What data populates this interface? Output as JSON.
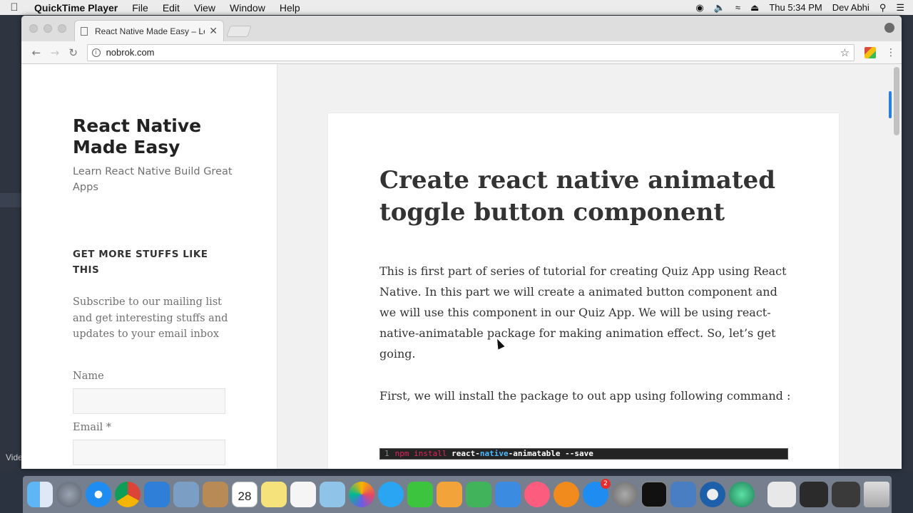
{
  "menubar": {
    "app_name": "QuickTime Player",
    "menus": [
      "File",
      "Edit",
      "View",
      "Window",
      "Help"
    ],
    "clock": "Thu 5:34 PM",
    "user": "Dev Abhi"
  },
  "background": {
    "video_label": "Vide"
  },
  "browser": {
    "tab_title": "React Native Made Easy – Lea",
    "url": "nobrok.com"
  },
  "sidebar": {
    "site_title": "React Native Made Easy",
    "site_description": "Learn React Native Build Great Apps",
    "widget_title": "GET MORE STUFFS LIKE THIS",
    "widget_text": "Subscribe to our mailing list and get interesting stuffs and updates to your email inbox",
    "name_label": "Name",
    "email_label": "Email *"
  },
  "article": {
    "title": "Create react native animated toggle button component",
    "paragraph1": "This is first part of series of tutorial for creating Quiz App using Re­act Native. In this part we will create a animated button component and we will use this component in our Quiz App.  We will be using react-native-animatable package for making animation ef­fect. So, let’s get going.",
    "paragraph2": "First, we will install the package to out app using following com­mand :",
    "code": {
      "line_number": "1",
      "cmd": "npm install",
      "pkg_a": "react-",
      "pkg_b": "native",
      "pkg_c": "-animatable --save"
    }
  },
  "dock": {
    "calendar_day": "28",
    "appstore_badge": "2"
  },
  "colors": {
    "link_blue": "#2a7de1",
    "code_keyword": "#e0245e",
    "code_native": "#4db8ff"
  }
}
